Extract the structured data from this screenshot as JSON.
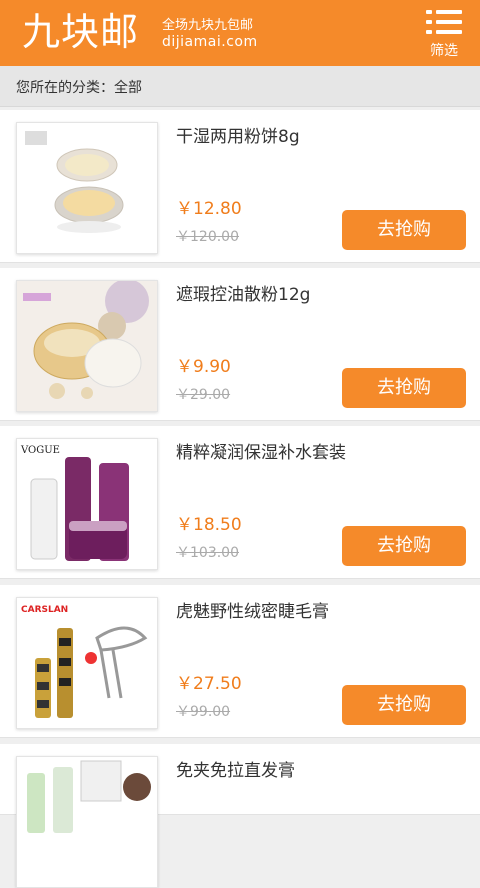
{
  "header": {
    "logo": "九块邮",
    "slogan": "全场九块九包邮",
    "domain": "dijiamai.com",
    "filter_label": "筛选"
  },
  "category": {
    "label": "您所在的分类：全部"
  },
  "products": [
    {
      "title": "干湿两用粉饼8g",
      "price": "￥12.80",
      "old_price": "￥120.00",
      "buy_label": "去抢购",
      "image": "compact-powder",
      "brand_text": ""
    },
    {
      "title": "遮瑕控油散粉12g",
      "price": "￥9.90",
      "old_price": "￥29.00",
      "buy_label": "去抢购",
      "image": "loose-powder",
      "brand_text": ""
    },
    {
      "title": "精粹凝润保湿补水套装",
      "price": "￥18.50",
      "old_price": "￥103.00",
      "buy_label": "去抢购",
      "image": "skincare-set",
      "brand_text": "VOGUE"
    },
    {
      "title": "虎魅野性绒密睫毛膏",
      "price": "￥27.50",
      "old_price": "￥99.00",
      "buy_label": "去抢购",
      "image": "mascara",
      "brand_text": "CARSLAN"
    },
    {
      "title": "免夹免拉直发膏",
      "price": "",
      "old_price": "",
      "buy_label": "",
      "image": "hair-cream",
      "brand_text": ""
    }
  ],
  "colors": {
    "accent": "#f58a2a",
    "price": "#f07d1c"
  }
}
